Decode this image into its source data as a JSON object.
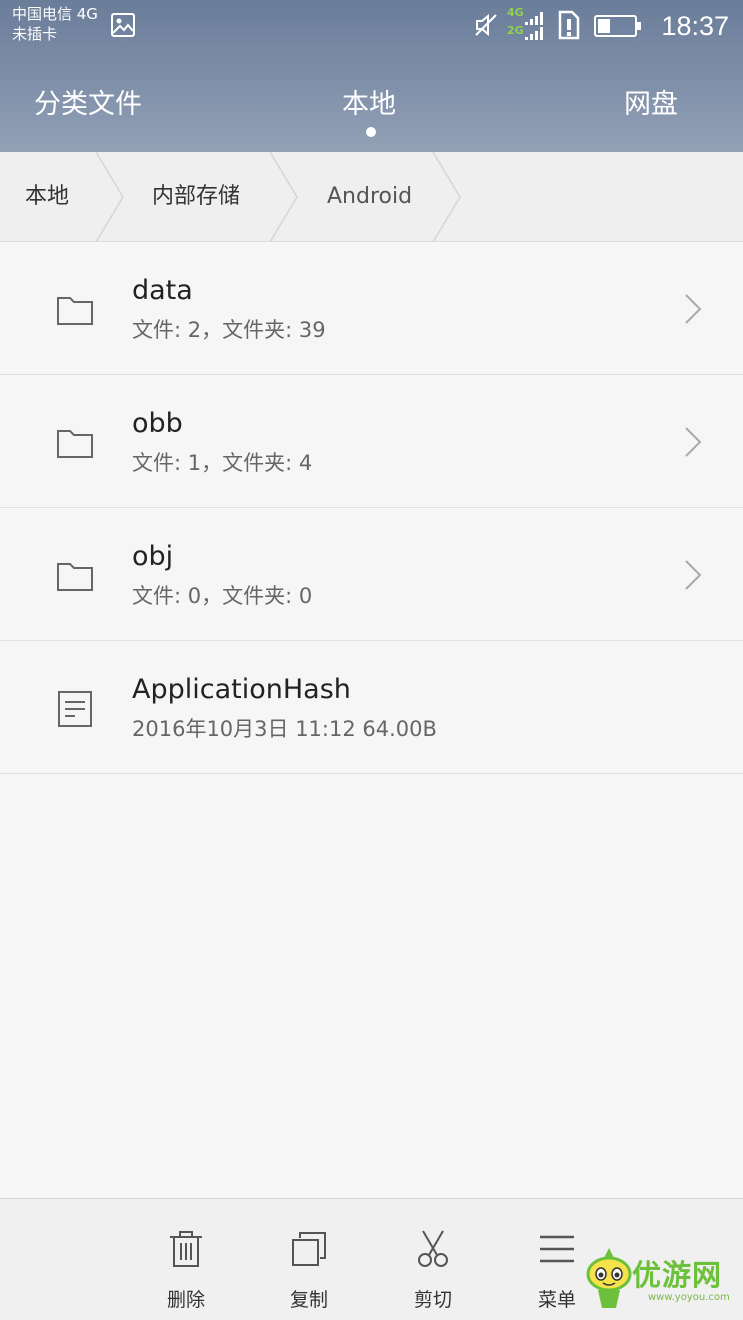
{
  "status_bar": {
    "carrier_line1": "中国电信 4G",
    "carrier_line2": "未插卡",
    "net_top": "4G",
    "net_bottom": "2G",
    "time": "18:37",
    "icons": [
      "image-icon",
      "mute-icon",
      "signal-icon",
      "sim-alert-icon",
      "battery-icon"
    ]
  },
  "tabs": [
    {
      "label": "分类文件"
    },
    {
      "label": "本地",
      "active": true
    },
    {
      "label": "网盘"
    }
  ],
  "breadcrumb": [
    "本地",
    "内部存储",
    "Android"
  ],
  "files": [
    {
      "name": "data",
      "meta": "文件: 2，文件夹: 39",
      "icon": "folder-icon"
    },
    {
      "name": "obb",
      "meta": "文件: 1，文件夹: 4",
      "icon": "folder-icon"
    },
    {
      "name": "obj",
      "meta": "文件: 0，文件夹: 0",
      "icon": "folder-icon"
    },
    {
      "name": "ApplicationHash",
      "meta": "2016年10月3日 11:12 64.00B",
      "icon": "document-icon"
    }
  ],
  "toolbar": [
    {
      "label": "删除",
      "icon": "trash-icon"
    },
    {
      "label": "复制",
      "icon": "copy-icon"
    },
    {
      "label": "剪切",
      "icon": "scissors-icon"
    },
    {
      "label": "菜单",
      "icon": "menu-icon"
    }
  ],
  "watermark": {
    "text": "优游网",
    "url": "www.yoyou.com"
  },
  "colors": {
    "header": "#7b8ca6",
    "background": "#f6f6f6",
    "network_badge": "#8fd14f",
    "watermark": "#6cc03a"
  }
}
